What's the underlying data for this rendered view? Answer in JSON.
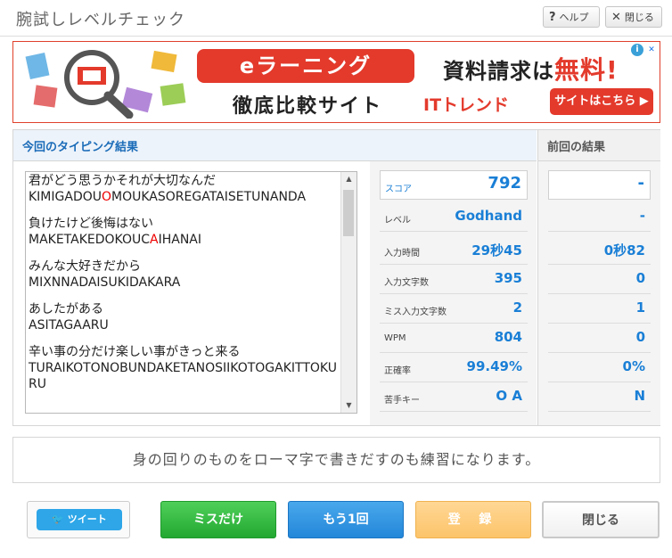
{
  "dialog": {
    "title": "腕試しレベルチェック",
    "help_label": "ヘルプ",
    "close_label": "閉じる"
  },
  "ad": {
    "pill_text": "eラーニング",
    "subtitle": "徹底比較サイト",
    "request_text": "資料請求は",
    "request_free": "無料!",
    "brand": "ITトレンド",
    "cta_label": "サイトはこちら ▶",
    "info_glyph": "i",
    "close_glyph": "✕"
  },
  "results": {
    "current_header": "今回のタイピング結果",
    "previous_header": "前回の結果",
    "typing_log": [
      {
        "jp": "君がどう思うかそれが大切なんだ",
        "pre": "KIMIGADOU",
        "miss": "O",
        "post": "MOUKASOREGATAISETUNANDA"
      },
      {
        "jp": "負けたけど後悔はない",
        "pre": "MAKETAKEDOKOUC",
        "miss": "A",
        "post": "IHANAI"
      },
      {
        "jp": "みんな大好きだから",
        "pre": "MIXNNADAISUKIDAKARA",
        "miss": "",
        "post": ""
      },
      {
        "jp": "あしたがある",
        "pre": "ASITAGAARU",
        "miss": "",
        "post": ""
      },
      {
        "jp": "辛い事の分だけ楽しい事がきっと来る",
        "pre": "TURAIKOTONOBUNDAKETANOSIIKOTOGAKITTOKURU",
        "miss": "",
        "post": ""
      }
    ],
    "stats": [
      {
        "label": "スコア",
        "current": "792",
        "previous": "-"
      },
      {
        "label": "レベル",
        "current": "Godhand",
        "previous": "-"
      },
      {
        "label": "入力時間",
        "current": "29秒45",
        "previous": "0秒82"
      },
      {
        "label": "入力文字数",
        "current": "395",
        "previous": "0"
      },
      {
        "label": "ミス入力文字数",
        "current": "2",
        "previous": "1"
      },
      {
        "label": "WPM",
        "current": "804",
        "previous": "0"
      },
      {
        "label": "正確率",
        "current": "99.49%",
        "previous": "0%"
      },
      {
        "label": "苦手キー",
        "current": "O A",
        "previous": "N"
      }
    ]
  },
  "tip": "身の回りのものをローマ字で書きだすのも練習になります。",
  "footer": {
    "tweet_label": "ツイート",
    "miss_only_label": "ミスだけ",
    "again_label": "もう1回",
    "register_label": "登 録",
    "close_label": "閉じる"
  },
  "background_window": {
    "close_glyph": "✕"
  },
  "colors": {
    "accent_blue": "#1a7fd6",
    "ad_red": "#e33a2c",
    "miss_red": "#ee0000",
    "green": "#23a832",
    "orange": "#fcc46a"
  }
}
